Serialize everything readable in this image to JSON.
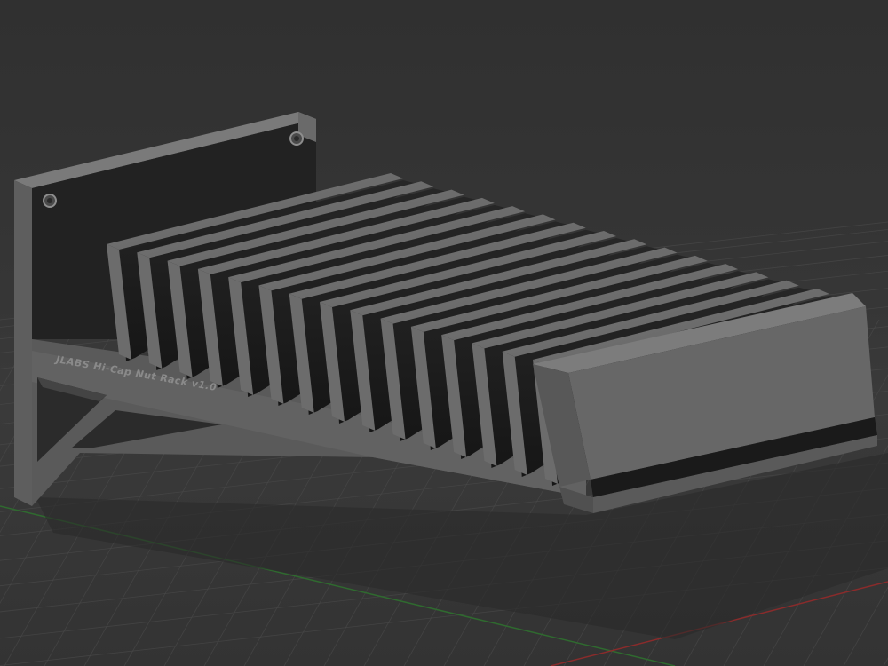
{
  "scene": {
    "model_engraving": "JLABS Hi-Cap Nut Rack v1.0",
    "colors": {
      "background": "#333333",
      "grid_line": "#4a4a4a",
      "model_body": "#5b5b5b",
      "model_face": "#686868",
      "model_dark": "#1c1c1c",
      "x_axis": "#8a2b2b",
      "y_axis": "#2f6a2f"
    }
  }
}
